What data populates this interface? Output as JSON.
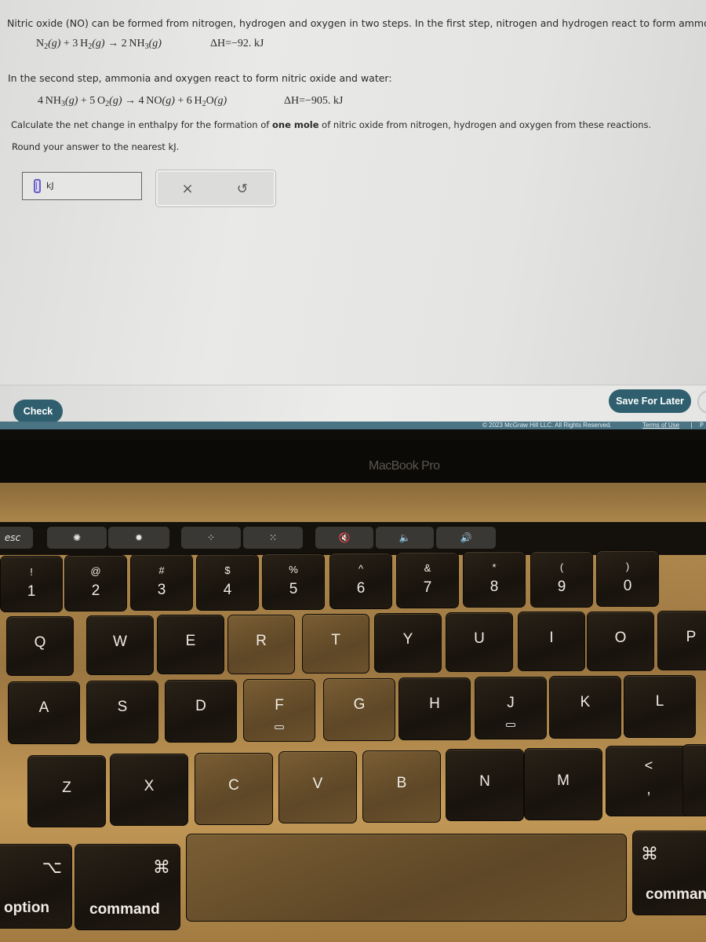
{
  "question": {
    "intro": "Nitric oxide (NO) can be formed from nitrogen, hydrogen and oxygen in two steps. In the first step, nitrogen and hydrogen react to form ammonia:",
    "reaction1": {
      "lhs1": "N",
      "lhs1_sub": "2",
      "lhs1_state": "(g)",
      "plus": " + 3 H",
      "lhs2_sub": "2",
      "lhs2_state": "(g)",
      "arrow": " → 2 NH",
      "rhs_sub": "3",
      "rhs_state": "(g)",
      "dH": "ΔH=−92. kJ"
    },
    "second_step": "In the second step, ammonia and oxygen react to form nitric oxide and water:",
    "reaction2": {
      "a": "4 NH",
      "a_sub": "3",
      "a_state": "(g)",
      "b": " + 5 O",
      "b_sub": "2",
      "b_state": "(g)",
      "c": " → 4 NO",
      "c_state": "(g)",
      "d": " + 6 H",
      "d_sub": "2",
      "d_tail": "O",
      "d_state": "(g)",
      "dH": "ΔH=−905. kJ"
    },
    "instruction_pre": "Calculate the net change in enthalpy for the formation of ",
    "instruction_bold": "one mole",
    "instruction_post": " of nitric oxide from nitrogen, hydrogen and oxygen from these reactions.",
    "round_note": "Round your answer to the nearest kJ."
  },
  "answer": {
    "value": "",
    "unit": "kJ"
  },
  "actions": {
    "clear_icon": "×",
    "undo_icon": "↺"
  },
  "footer": {
    "check_label": "Check",
    "save_label": "Save For Later",
    "copyright": "© 2023 McGraw Hill LLC. All Rights Reserved.",
    "terms": "Terms of Use",
    "separator": "|",
    "privacy_partial": "P"
  },
  "colors": {
    "button": "#2f5f6e",
    "footer_strip": "#4a7383",
    "cursor_accent": "#6b5fc7"
  },
  "device": {
    "label": "MacBook Pro"
  },
  "touchbar": [
    "esc",
    "brightness-down-icon",
    "brightness-up-icon",
    "kbd-backlight-down-icon",
    "kbd-backlight-up-icon",
    "mute-icon",
    "volume-down-icon",
    "volume-up-icon"
  ],
  "keyboard": {
    "number_row": [
      {
        "top": "!",
        "bot": "1"
      },
      {
        "top": "@",
        "bot": "2"
      },
      {
        "top": "#",
        "bot": "3"
      },
      {
        "top": "$",
        "bot": "4"
      },
      {
        "top": "%",
        "bot": "5"
      },
      {
        "top": "^",
        "bot": "6"
      },
      {
        "top": "&",
        "bot": "7"
      },
      {
        "top": "*",
        "bot": "8"
      },
      {
        "top": "(",
        "bot": "9"
      },
      {
        "top": ")",
        "bot": "0"
      }
    ],
    "qwerty_row": [
      "Q",
      "W",
      "E",
      "R",
      "T",
      "Y",
      "U",
      "I",
      "O",
      "P"
    ],
    "home_row": [
      "A",
      "S",
      "D",
      "F",
      "G",
      "H",
      "J",
      "K",
      "L"
    ],
    "bottom_row": [
      "Z",
      "X",
      "C",
      "V",
      "B",
      "N",
      "M"
    ],
    "comma": {
      "top": "<",
      "bot": ","
    },
    "option": {
      "sym": "⌥",
      "label": "option"
    },
    "command_left": {
      "sym": "⌘",
      "label": "command"
    },
    "command_right": {
      "sym": "⌘",
      "label": "comman"
    }
  }
}
